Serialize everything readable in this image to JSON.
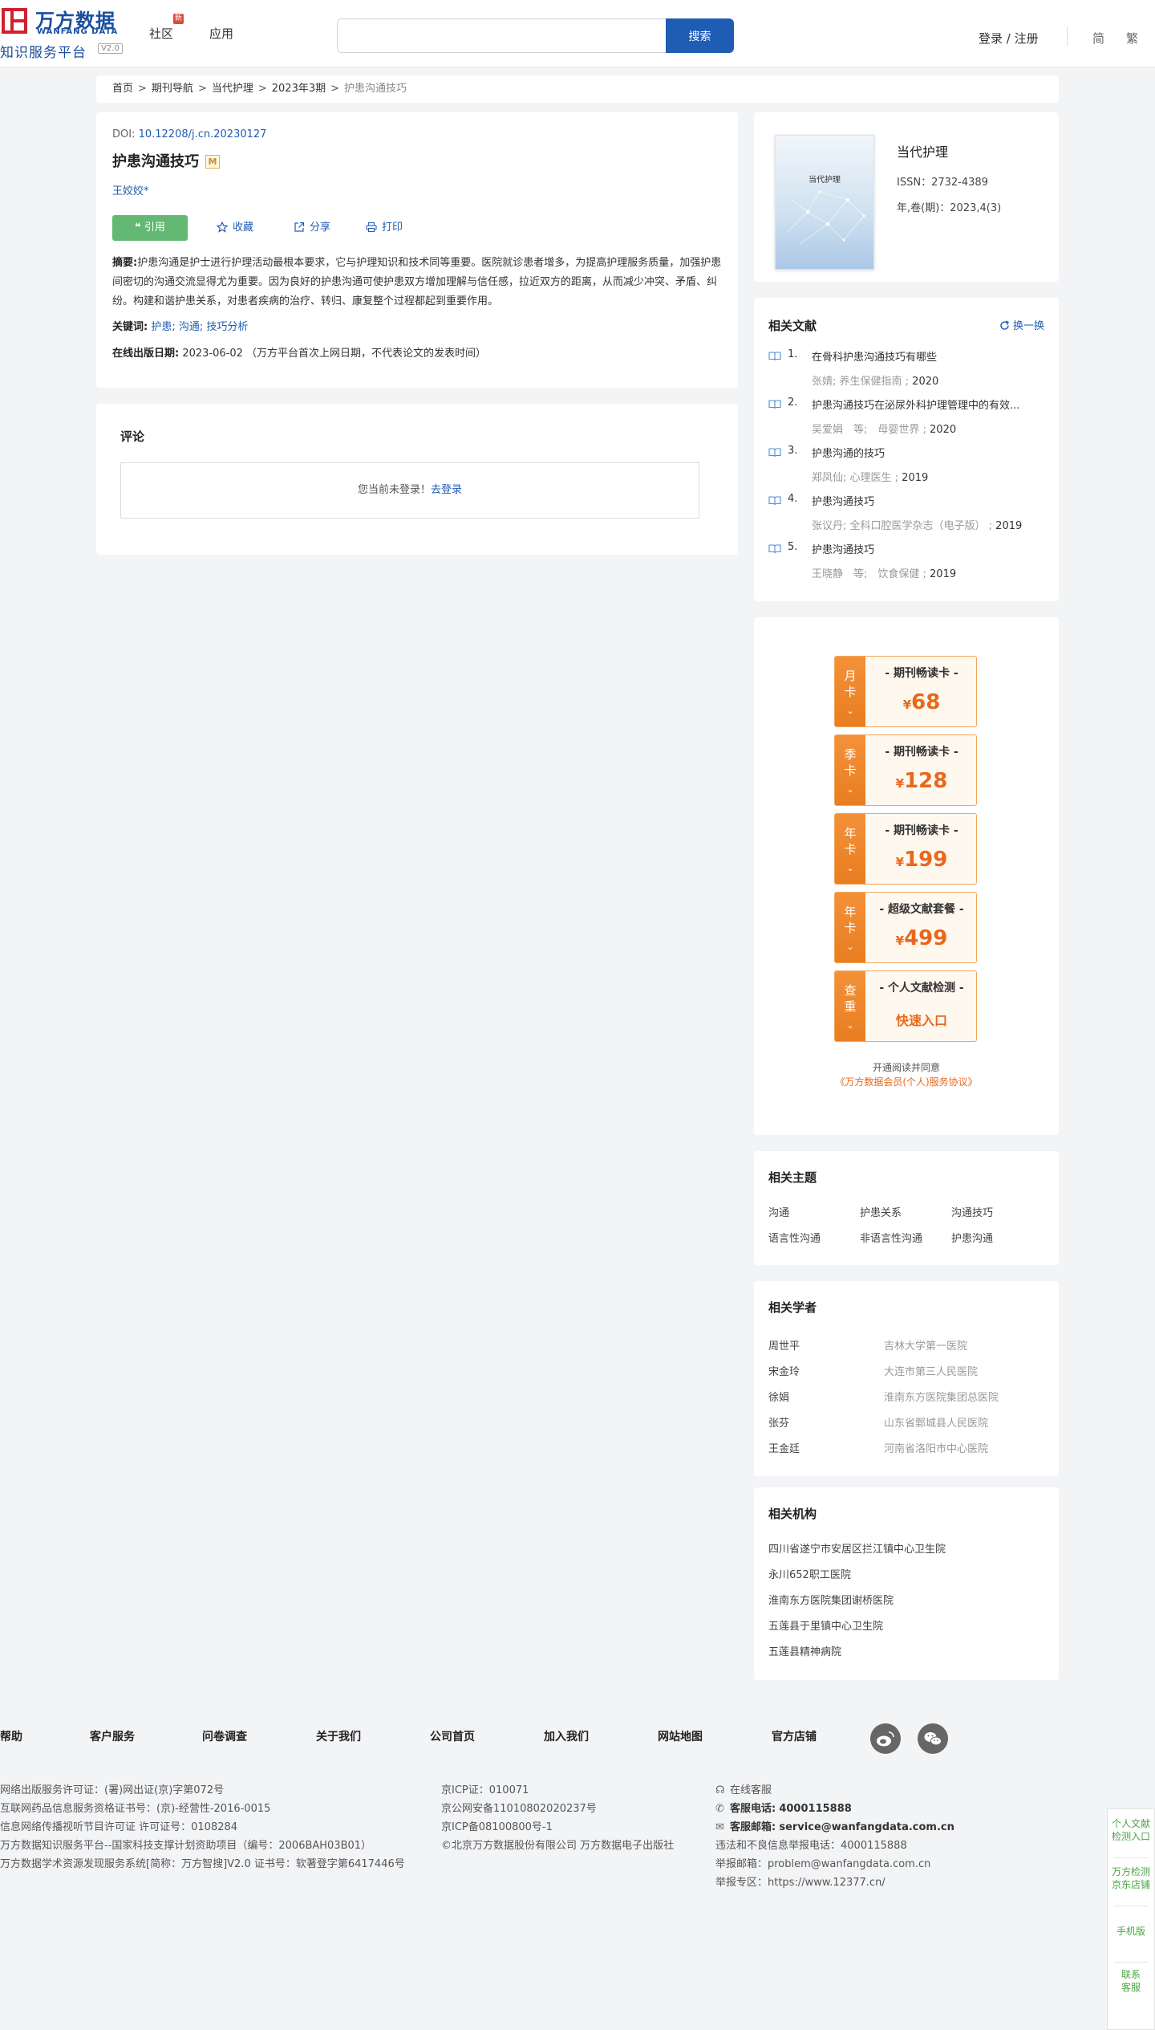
{
  "header": {
    "logo_cn": "万方数据",
    "logo_en": "WANFANG DATA",
    "logo_sub": "知识服务平台",
    "logo_ver": "V2.0",
    "nav": [
      "社区",
      "应用"
    ],
    "community_badge": "新",
    "search_placeholder": "",
    "search_button": "搜索",
    "login": "登录 / 注册",
    "lang_simplified": "简",
    "lang_traditional": "繁"
  },
  "breadcrumb": {
    "items": [
      "首页",
      "期刊导航",
      "当代护理",
      "2023年3期"
    ],
    "current": "护患沟通技巧",
    "separator": ">"
  },
  "article": {
    "doi_label": "DOI: ",
    "doi": "10.12208/j.cn.20230127",
    "title": "护患沟通技巧",
    "badge": "M",
    "author": "王姣姣*",
    "cite": "引用",
    "favorite": "收藏",
    "share": "分享",
    "print": "打印",
    "abstract_label": "摘要:",
    "abstract": "护患沟通是护士进行护理活动最根本要求，它与护理知识和技术同等重要。医院就诊患者增多，为提高护理服务质量，加强护患间密切的沟通交流显得尤为重要。因为良好的护患沟通可使护患双方增加理解与信任感，拉近双方的距离，从而减少冲突、矛盾、纠纷。构建和谐护患关系，对患者疾病的治疗、转归、康复整个过程都起到重要作用。",
    "keywords_label": "关键词:",
    "keywords": "护患; 沟通; 技巧分析",
    "pubdate_label": "在线出版日期:",
    "pubdate": "2023-06-02",
    "pubdate_note": "（万方平台首次上网日期，不代表论文的发表时间）"
  },
  "comment": {
    "title": "评论",
    "not_logged": "您当前未登录！",
    "login_link": "去登录"
  },
  "journal": {
    "cover_title": "当代护理",
    "name": "当代护理",
    "issn": "ISSN：2732-4389",
    "year_vol": "年,卷(期)：2023,4(3)"
  },
  "related_docs": {
    "title": "相关文献",
    "switch": "换一换",
    "items": [
      {
        "num": "1.",
        "title": "在骨科护患沟通技巧有哪些",
        "meta": "张婧; 养生保健指南 ; ",
        "year": "2020"
      },
      {
        "num": "2.",
        "title": "护患沟通技巧在泌尿外科护理管理中的有效...",
        "meta": "吴爱娟　等;　母婴世界 ; ",
        "year": "2020"
      },
      {
        "num": "3.",
        "title": "护患沟通的技巧",
        "meta": "郑凤仙; 心理医生 ; ",
        "year": "2019"
      },
      {
        "num": "4.",
        "title": "护患沟通技巧",
        "meta": "张议丹; 全科口腔医学杂志（电子版） ; ",
        "year": "2019"
      },
      {
        "num": "5.",
        "title": "护患沟通技巧",
        "meta": "王晓静　等;　饮食保健 ; ",
        "year": "2019"
      }
    ]
  },
  "promo": {
    "cards": [
      {
        "side": [
          "月",
          "卡"
        ],
        "type": "- 期刊畅读卡 -",
        "currency": "¥",
        "price": "68"
      },
      {
        "side": [
          "季",
          "卡"
        ],
        "type": "- 期刊畅读卡 -",
        "currency": "¥",
        "price": "128"
      },
      {
        "side": [
          "年",
          "卡"
        ],
        "type": "- 期刊畅读卡 -",
        "currency": "¥",
        "price": "199"
      },
      {
        "side": [
          "年",
          "卡"
        ],
        "type": "- 超级文献套餐 -",
        "currency": "¥",
        "price": "499"
      },
      {
        "side": [
          "查",
          "重"
        ],
        "type": "- 个人文献检测 -",
        "link": "快速入口"
      }
    ],
    "arrow": "≚",
    "note": "开通阅读并同意",
    "agreement": "《万方数据会员(个人)服务协议》"
  },
  "topics": {
    "title": "相关主题",
    "items": [
      "沟通",
      "护患关系",
      "沟通技巧",
      "语言性沟通",
      "非语言性沟通",
      "护患沟通"
    ]
  },
  "scholars": {
    "title": "相关学者",
    "items": [
      {
        "name": "周世平",
        "org": "吉林大学第一医院"
      },
      {
        "name": "宋金玲",
        "org": "大连市第三人民医院"
      },
      {
        "name": "徐娟",
        "org": "淮南东方医院集团总医院"
      },
      {
        "name": "张芬",
        "org": "山东省鄄城县人民医院"
      },
      {
        "name": "王金廷",
        "org": "河南省洛阳市中心医院"
      }
    ]
  },
  "institutions": {
    "title": "相关机构",
    "items": [
      "四川省遂宁市安居区拦江镇中心卫生院",
      "永川652职工医院",
      "淮南东方医院集团谢桥医院",
      "五莲县于里镇中心卫生院",
      "五莲县精神病院"
    ]
  },
  "footer": {
    "nav": [
      "帮助",
      "客户服务",
      "问卷调查",
      "关于我们",
      "公司首页",
      "加入我们",
      "网站地图",
      "官方店铺"
    ],
    "col1": [
      "网络出版服务许可证：(署)网出证(京)字第072号",
      "互联网药品信息服务资格证书号：(京)-经营性-2016-0015",
      "信息网络传播视听节目许可证 许可证号：0108284",
      "万方数据知识服务平台--国家科技支撑计划资助项目（编号：2006BAH03B01）",
      "万方数据学术资源发现服务系统[简称：万方智搜]V2.0 证书号：软著登字第6417446号"
    ],
    "col2": [
      "京ICP证：010071",
      "京公网安备11010802020237号",
      "京ICP备08100800号-1",
      "©北京万方数据股份有限公司 万方数据电子出版社"
    ],
    "online_service": "在线客服",
    "phone_label": "客服电话:",
    "phone": "4000115888",
    "email_label": "客服邮箱:",
    "email": "service@wanfangdata.com.cn",
    "report_phone": "违法和不良信息举报电话：4000115888",
    "report_email": "举报邮箱：problem@wanfangdata.com.cn",
    "report_zone": "举报专区：https://www.12377.cn/"
  },
  "float_bar": {
    "items": [
      [
        "个人文献",
        "检测入口"
      ],
      [
        "万方检测",
        "京东店铺"
      ],
      [
        "手机版"
      ],
      [
        "联系",
        "客服"
      ]
    ]
  },
  "colors": {
    "brand_blue": "#1f5db5",
    "logo_red": "#d2202e",
    "cite_green": "#63b874",
    "promo_orange": "#e8681b"
  }
}
